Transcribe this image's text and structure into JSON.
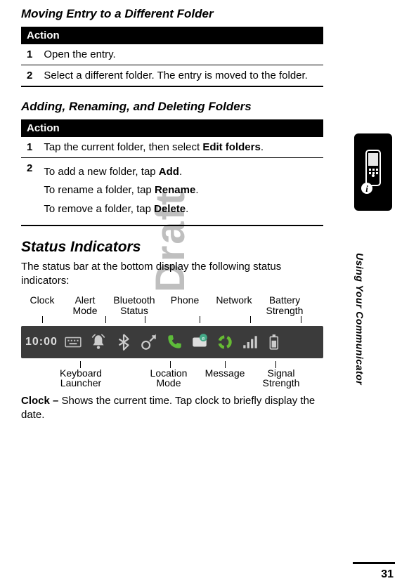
{
  "section1": {
    "title": "Moving Entry to a Different Folder",
    "action_header": "Action",
    "steps": [
      {
        "num": "1",
        "text": "Open the entry."
      },
      {
        "num": "2",
        "text": "Select a different folder. The entry is moved to the folder."
      }
    ]
  },
  "section2": {
    "title": "Adding, Renaming, and Deleting Folders",
    "action_header": "Action",
    "step1": {
      "num": "1",
      "text_pre": "Tap the current folder, then select ",
      "ui": "Edit folders",
      "text_post": "."
    },
    "step2": {
      "num": "2",
      "line1_pre": "To add a new folder, tap ",
      "line1_ui": "Add",
      "line1_post": ".",
      "line2_pre": "To rename a folder, tap ",
      "line2_ui": "Rename",
      "line2_post": ".",
      "line3_pre": "To remove a folder, tap ",
      "line3_ui": "Delete",
      "line3_post": "."
    }
  },
  "section3": {
    "heading": "Status Indicators",
    "intro": "The status bar at the bottom display the following status indicators:",
    "labels_top": {
      "clock": "Clock",
      "alert": "Alert\nMode",
      "bt": "Bluetooth\nStatus",
      "phone": "Phone",
      "network": "Network",
      "battery": "Battery\nStrength"
    },
    "statusbar": {
      "clock": "10:00"
    },
    "labels_bottom": {
      "keyboard": "Keyboard\nLauncher",
      "location": "Location\nMode",
      "message": "Message",
      "signal": "Signal\nStrength"
    },
    "clock_desc_bold": "Clock – ",
    "clock_desc": "Shows the current time. Tap clock to briefly display the date."
  },
  "sidebar": {
    "label": "Using Your Communicator"
  },
  "watermark": "Draft",
  "page_number": "31"
}
